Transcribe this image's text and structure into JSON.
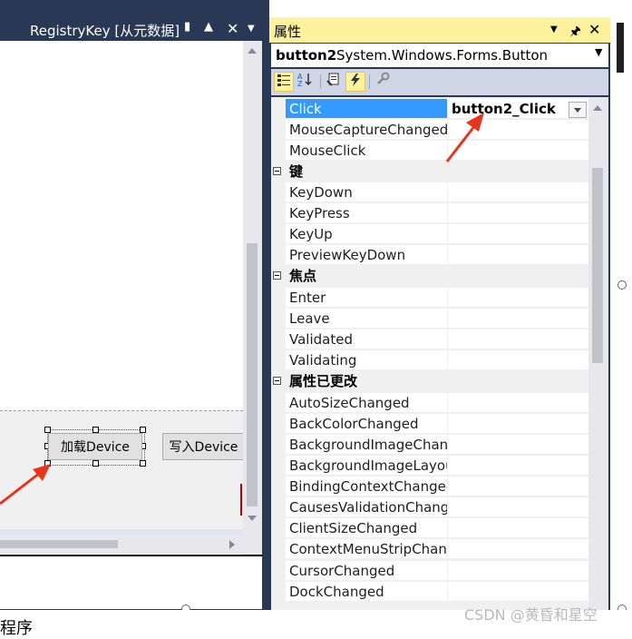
{
  "designer": {
    "tab_title": "RegistryKey [从元数据]",
    "buttons": [
      {
        "label": "加载Device"
      },
      {
        "label": "写入Device"
      }
    ]
  },
  "properties_panel": {
    "title": "属性",
    "object_name": "button2",
    "object_type": "System.Windows.Forms.Button",
    "toolbar_icons": [
      "categorized-icon",
      "alphabetical-icon",
      "properties-icon",
      "events-icon",
      "property-pages-icon"
    ],
    "active_toolbar_icon": "events-icon",
    "rows": [
      {
        "kind": "prop",
        "name": "Click",
        "value": "button2_Click",
        "selected": true
      },
      {
        "kind": "prop",
        "name": "MouseCaptureChanged",
        "value": ""
      },
      {
        "kind": "prop",
        "name": "MouseClick",
        "value": ""
      },
      {
        "kind": "category",
        "name": "键"
      },
      {
        "kind": "prop",
        "name": "KeyDown",
        "value": ""
      },
      {
        "kind": "prop",
        "name": "KeyPress",
        "value": ""
      },
      {
        "kind": "prop",
        "name": "KeyUp",
        "value": ""
      },
      {
        "kind": "prop",
        "name": "PreviewKeyDown",
        "value": ""
      },
      {
        "kind": "category",
        "name": "焦点"
      },
      {
        "kind": "prop",
        "name": "Enter",
        "value": ""
      },
      {
        "kind": "prop",
        "name": "Leave",
        "value": ""
      },
      {
        "kind": "prop",
        "name": "Validated",
        "value": ""
      },
      {
        "kind": "prop",
        "name": "Validating",
        "value": ""
      },
      {
        "kind": "category",
        "name": "属性已更改"
      },
      {
        "kind": "prop",
        "name": "AutoSizeChanged",
        "value": ""
      },
      {
        "kind": "prop",
        "name": "BackColorChanged",
        "value": ""
      },
      {
        "kind": "prop",
        "name": "BackgroundImageChanged",
        "value": ""
      },
      {
        "kind": "prop",
        "name": "BackgroundImageLayoutChanged",
        "value": ""
      },
      {
        "kind": "prop",
        "name": "BindingContextChanged",
        "value": ""
      },
      {
        "kind": "prop",
        "name": "CausesValidationChanged",
        "value": ""
      },
      {
        "kind": "prop",
        "name": "ClientSizeChanged",
        "value": ""
      },
      {
        "kind": "prop",
        "name": "ContextMenuStripChanged",
        "value": ""
      },
      {
        "kind": "prop",
        "name": "CursorChanged",
        "value": ""
      },
      {
        "kind": "prop",
        "name": "DockChanged",
        "value": ""
      }
    ]
  },
  "footer": {
    "left_text": "程序",
    "watermark": "CSDN @黄昏和星空"
  },
  "colors": {
    "ide_dark": "#293955",
    "panel_header": "#fff29d",
    "selected_row": "#3399ff",
    "annotation_arrow": "#e8341c"
  }
}
